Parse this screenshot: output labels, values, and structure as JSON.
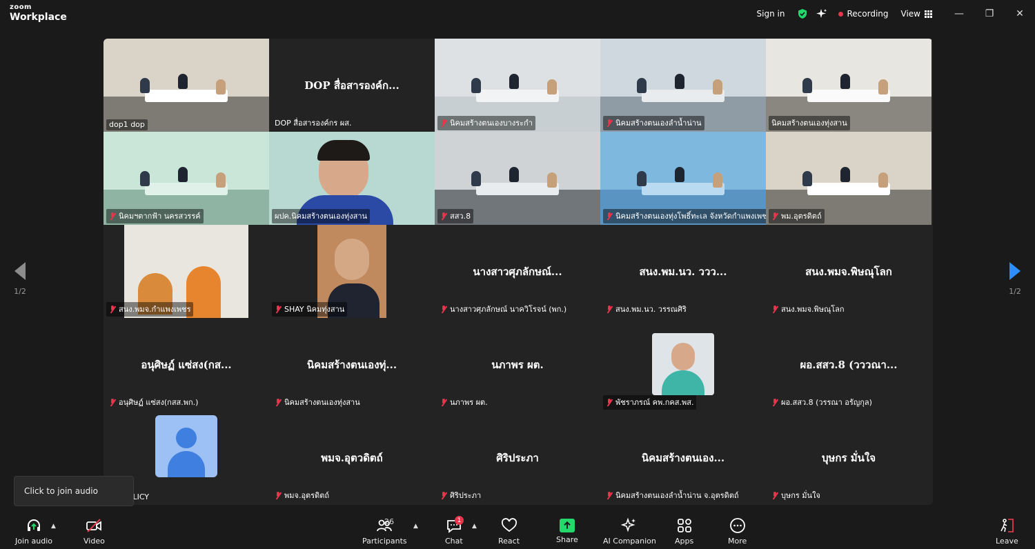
{
  "app": {
    "brand_top": "zoom",
    "brand_bottom": "Workplace"
  },
  "titlebar": {
    "sign_in": "Sign in",
    "recording": "Recording",
    "view": "View"
  },
  "window_buttons": [
    "—",
    "❐",
    "✕"
  ],
  "pager": {
    "left": "1/2",
    "right": "1/2"
  },
  "colors": {
    "accent": "#2d8cff",
    "active_speaker": "#23d96c",
    "muted": "#e5364b"
  },
  "tiles": [
    {
      "type": "video",
      "label": "dop1 dop",
      "muted": false
    },
    {
      "type": "name",
      "name": "DOP สื่อสารองค์ก...",
      "label": "DOP สื่อสารองค์กร ผส.",
      "muted": false
    },
    {
      "type": "video",
      "label": "นิคมสร้างตนเองบางระกำ",
      "muted": true
    },
    {
      "type": "video",
      "label": "นิคมสร้างตนเองลำน้ำน่าน",
      "muted": true
    },
    {
      "type": "video",
      "label": "นิคมสร้างตนเองทุ่งสาน",
      "muted": false
    },
    {
      "type": "video",
      "label": "นิคมฯตากฟ้า นครสวรรค์",
      "muted": true
    },
    {
      "type": "video",
      "label": "ผปค.นิคมสร้างตนเองทุ่งสาน",
      "muted": false,
      "active": true
    },
    {
      "type": "video",
      "label": "สสว.8",
      "muted": true
    },
    {
      "type": "video",
      "label": "นิคมสร้างตนเองทุ่งโพธิ์ทะเล จังหวัดกำแพงเพชร",
      "muted": true
    },
    {
      "type": "video",
      "label": "พม.อุตรดิตถ์",
      "muted": true
    },
    {
      "type": "thumb",
      "label": "สนง.พมจ.กำแพงเพชร",
      "muted": true
    },
    {
      "type": "thumb",
      "label": "SHAY นิคมทุ่งสาน",
      "muted": true
    },
    {
      "type": "name",
      "name": "นางสาวศุภลักษณ์...",
      "label": "นางสาวศุภลักษณ์ นาควิโรจน์ (พก.)",
      "muted": true
    },
    {
      "type": "name",
      "name": "สนง.พม.นว. ววว...",
      "label": "สนง.พม.นว. วรรณศิริ",
      "muted": true
    },
    {
      "type": "name",
      "name": "สนง.พมจ.พิษณุโลก",
      "label": "สนง.พมจ.พิษณุโลก",
      "muted": true
    },
    {
      "type": "name",
      "name": "อนุศิษฏ์ แซ่สง(กส...",
      "label": "อนุศิษฏ์ แซ่สง(กสส.พก.)",
      "muted": true
    },
    {
      "type": "name",
      "name": "นิคมสร้างตนเองทุ่...",
      "label": "นิคมสร้างตนเองทุ่งสาน",
      "muted": true
    },
    {
      "type": "name",
      "name": "นภาพร ผต.",
      "label": "นภาพร ผต.",
      "muted": true
    },
    {
      "type": "thumb",
      "label": "พัชราภรณ์ คพ.กคส.พส.",
      "muted": true
    },
    {
      "type": "name",
      "name": "ผอ.สสว.8 (วววณา...",
      "label": "ผอ.สสว.8 (วรรณา อรัญกุล)",
      "muted": true
    },
    {
      "type": "avatar",
      "label": "O8 POLICY",
      "muted": false
    },
    {
      "type": "name",
      "name": "พมจ.อุตวดิตถ์",
      "label": "พมจ.อุตรดิตถ์",
      "muted": true
    },
    {
      "type": "name",
      "name": "ศิริประภา",
      "label": "ศิริประภา",
      "muted": true
    },
    {
      "type": "name",
      "name": "นิคมสร้างตนเอง...",
      "label": "นิคมสร้างตนเองลำน้ำน่าน จ.อุตรดิตถ์",
      "muted": true
    },
    {
      "type": "name",
      "name": "บุษกร มั่นใจ",
      "label": "บุษกร มั่นใจ",
      "muted": true
    }
  ],
  "tooltip": "Click to join audio",
  "toolbar": {
    "join_audio": "Join audio",
    "video": "Video",
    "participants": "Participants",
    "participants_count": "26",
    "chat": "Chat",
    "chat_badge": "1",
    "react": "React",
    "share": "Share",
    "ai_companion": "AI Companion",
    "apps": "Apps",
    "more": "More",
    "leave": "Leave"
  }
}
